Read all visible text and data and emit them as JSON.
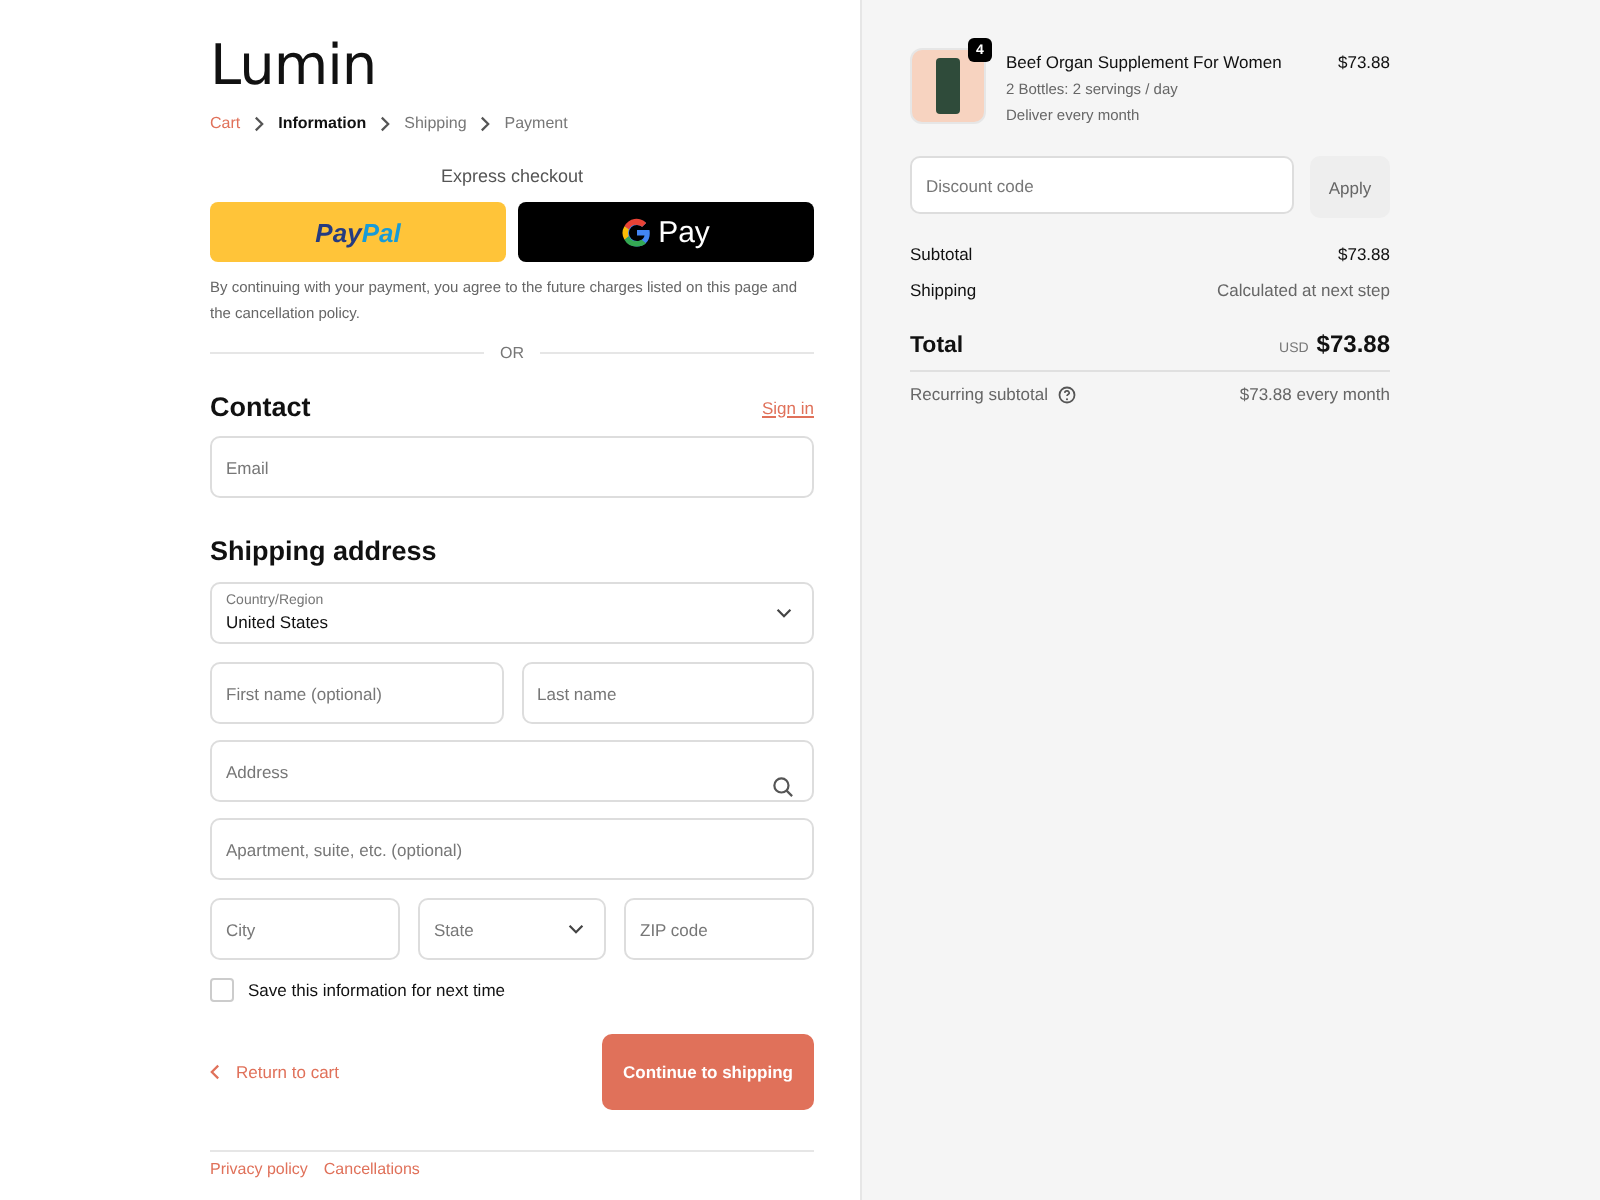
{
  "logo": "Lumin",
  "breadcrumb": [
    {
      "label": "Cart",
      "kind": "link",
      "selected": false
    },
    {
      "label": "Information",
      "kind": "step",
      "selected": true
    },
    {
      "label": "Shipping",
      "kind": "step",
      "selected": false
    },
    {
      "label": "Payment",
      "kind": "step",
      "selected": false
    }
  ],
  "express": {
    "title": "Express checkout",
    "paypal": {
      "part1": "Pay",
      "part2": "Pal"
    },
    "gpay": "Pay",
    "notice": "By continuing with your payment, you agree to the future charges listed on this page and the cancellation policy.",
    "divider": "OR"
  },
  "contact": {
    "title": "Contact",
    "sign_in": "Sign in",
    "email": {
      "placeholder": "Email"
    }
  },
  "shipping": {
    "title": "Shipping address",
    "country": {
      "label": "Country/Region",
      "value": "United States"
    },
    "first_name": {
      "placeholder": "First name (optional)"
    },
    "last_name": {
      "placeholder": "Last name"
    },
    "address": {
      "placeholder": "Address"
    },
    "apartment": {
      "placeholder": "Apartment, suite, etc. (optional)"
    },
    "city": {
      "placeholder": "City"
    },
    "state": {
      "placeholder": "State"
    },
    "zip": {
      "placeholder": "ZIP code"
    },
    "save": {
      "label": "Save this information for next time",
      "checked": false
    }
  },
  "actions": {
    "back": "Return to cart",
    "continue": "Continue to shipping"
  },
  "footer": [
    "Privacy policy",
    "Cancellations"
  ],
  "summary": {
    "item": {
      "quantity": "4",
      "name": "Beef Organ Supplement For Women",
      "variant": "2 Bottles: 2 servings / day",
      "plan": "Deliver every month",
      "price": "$73.88"
    },
    "discount": {
      "placeholder": "Discount code",
      "button": "Apply"
    },
    "subtotal": {
      "label": "Subtotal",
      "value": "$73.88"
    },
    "shipping": {
      "label": "Shipping",
      "value": "Calculated at next step"
    },
    "total": {
      "label": "Total",
      "currency": "USD",
      "value": "$73.88"
    },
    "recurring": {
      "label": "Recurring subtotal",
      "value": "$73.88 every month"
    }
  }
}
